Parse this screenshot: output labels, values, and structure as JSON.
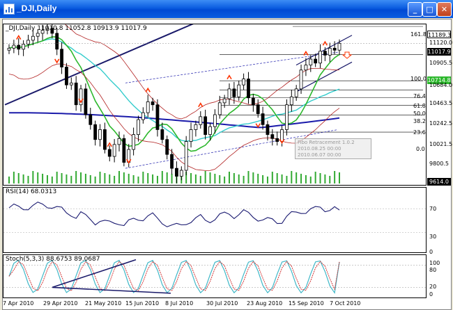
{
  "window": {
    "title": "_DJI,Daily",
    "buttons": {
      "minimize": "_",
      "maximize": "□",
      "close": "✕"
    }
  },
  "price_pane": {
    "header": "_DJI,Daily  11010.8 11052.8 10913.9 11017.9",
    "yticks": [
      "11120.0",
      "10905.5",
      "10684.0",
      "10463.5",
      "10242.5",
      "10021.5",
      "9800.5"
    ],
    "boxes": {
      "hi": "11189.3",
      "cur": "11017.9",
      "ma": "10714.8",
      "low": "9614.0"
    },
    "fib_levels": [
      "161.8",
      "100.0",
      "76.4",
      "61.8",
      "50.0",
      "38.2",
      "23.6",
      "0.0"
    ],
    "tooltip": [
      "Fibo Retracement 1.0.2",
      "2010.08.25 00:00",
      "2010.06.07 00:00"
    ]
  },
  "rsi_pane": {
    "header": "RSI(14) 68.0313",
    "yticks": [
      "70",
      "30",
      "0"
    ]
  },
  "stoch_pane": {
    "header": "Stoch(5,3,3) 88.6753 89.0687",
    "yticks": [
      "100",
      "80",
      "20",
      "0"
    ]
  },
  "x_axis": [
    "7 Apr 2010",
    "29 Apr 2010",
    "21 May 2010",
    "15 Jun 2010",
    "8 Jul 2010",
    "30 Jul 2010",
    "23 Aug 2010",
    "15 Sep 2010",
    "7 Oct 2010"
  ],
  "colors": {
    "titlebar": "#0a5ce0",
    "candle": "#000000",
    "bollinger": "#b22222",
    "ma_fast": "#2db82d",
    "ma_mid": "#33cccc",
    "ma_slow": "#1a1aaa",
    "volume": "#33aa33",
    "rsi": "#191970",
    "stoch_main": "#40b8c8",
    "stoch_signal": "#cc2222",
    "arrow": "#ff3300"
  },
  "chart_data": {
    "type": "candlestick",
    "title": "_DJI,Daily",
    "symbol": "_DJI",
    "timeframe": "Daily",
    "last_bar": {
      "open": 11010.8,
      "high": 11052.8,
      "low": 10913.9,
      "close": 11017.9
    },
    "ylim": [
      9614.0,
      11189.3
    ],
    "closes": [
      10970,
      11000,
      10960,
      11010,
      11050,
      11090,
      11120,
      11150,
      11170,
      11120,
      10960,
      10780,
      10600,
      10620,
      10400,
      10560,
      10300,
      10200,
      10050,
      10150,
      9950,
      9880,
      10000,
      10060,
      9820,
      9950,
      10100,
      10250,
      10320,
      10430,
      10400,
      10150,
      10050,
      9900,
      9760,
      9680,
      9740,
      10030,
      10150,
      10200,
      10280,
      10100,
      10180,
      10300,
      10420,
      10460,
      10560,
      10480,
      10600,
      10660,
      10470,
      10400,
      10310,
      10200,
      10100,
      10060,
      10030,
      10150,
      10400,
      10480,
      10560,
      10750,
      10800,
      10860,
      10820,
      10940,
      10900,
      10970,
      10950,
      11017.9
    ],
    "rsi": {
      "period": 14,
      "last": 68.0313
    },
    "stoch": {
      "params": [
        5,
        3,
        3
      ],
      "main": 88.6753,
      "signal": 89.0687
    },
    "fibonacci": {
      "levels": [
        161.8,
        100.0,
        76.4,
        61.8,
        50.0,
        38.2,
        23.6,
        0.0
      ]
    }
  }
}
